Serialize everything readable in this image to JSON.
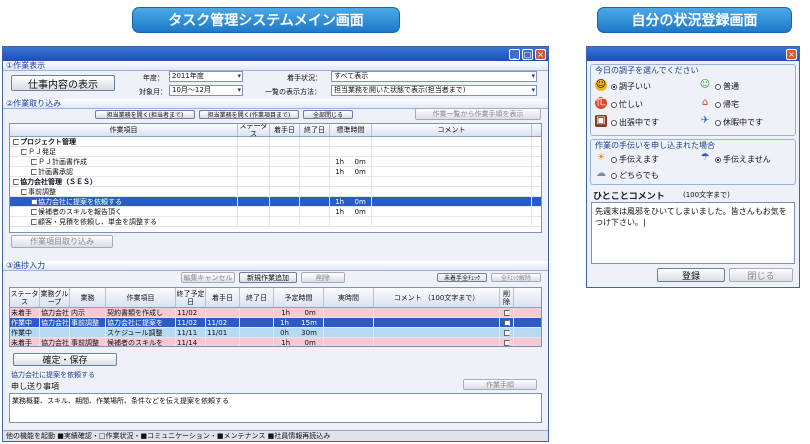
{
  "banners": {
    "main": "タスク管理システムメイン画面",
    "status": "自分の状況登録画面"
  },
  "main": {
    "sec1_title": "①作業表示",
    "show_button": "仕事内容の表示",
    "year_label": "年度：",
    "year_value": "2011年度",
    "period_label": "対象月：",
    "period_value": "10月〜12月",
    "status_label": "着手状況：",
    "status_value": "すべて表示",
    "display_label": "一覧の表示方法：",
    "display_value": "担当業務を開いた状態で表示(担当者まで)",
    "sec2_title": "②作業取り込み",
    "toolbar": [
      "担当業務を開く(担当者まで)",
      "担当業務を開く(作業項目まで)",
      "全部閉じる"
    ],
    "import_button_top": "作業一覧から作業手順を表示",
    "task_cols": [
      "作業項目",
      "ステータス",
      "着手日",
      "終了日",
      "標準時間",
      "コメント"
    ],
    "task_rows": [
      {
        "name": "プロジェクト管理",
        "h": "",
        "m": ""
      },
      {
        "name": "ＰＪ発足",
        "h": "",
        "m": ""
      },
      {
        "name": "ＰＪ計画書作成",
        "h": "1h",
        "m": "0m"
      },
      {
        "name": "計画書承認",
        "h": "1h",
        "m": "0m"
      },
      {
        "name": "協力会社管理（ＳＥＳ）",
        "h": "",
        "m": ""
      },
      {
        "name": "事前調整",
        "h": "",
        "m": ""
      },
      {
        "name": "協力会社に提案を依頼する",
        "h": "1h",
        "m": "0m"
      },
      {
        "name": "候補者のスキルを報告頂く",
        "h": "1h",
        "m": "0m"
      },
      {
        "name": "顧客・見積を依頼し、単金を調整する",
        "h": "",
        "m": ""
      }
    ],
    "import_button": "作業項目取り込み",
    "sec3_title": "③進捗入力",
    "prog_buttons": [
      "編集キャンセル",
      "新規作業追加",
      "削除"
    ],
    "prog_right_buttons": [
      "未着手全ﾁｪｯｸ",
      "全ﾁｪｯｸ解除"
    ],
    "prog_cols": [
      "ステータス",
      "業務グループ",
      "業務",
      "作業項目",
      "終了予定日",
      "着手日",
      "終了日",
      "予定時間",
      "実時間",
      "コメント （100文字まで）",
      "削除"
    ],
    "prog_rows": [
      {
        "status": "未着手",
        "group": "協力会社",
        "biz": "内示",
        "item": "契約書類を作成し",
        "due": "11/02",
        "start": "",
        "end": "",
        "ph": "1h",
        "pm": "0m",
        "style": "pk"
      },
      {
        "status": "作業中",
        "group": "協力会社",
        "biz": "事前調整",
        "item": "協力会社に提案を",
        "due": "11/02",
        "start": "11/02",
        "end": "",
        "ph": "1h",
        "pm": "15m",
        "style": "hl"
      },
      {
        "status": "作業中",
        "group": "",
        "biz": "",
        "item": "スケジュール調整",
        "due": "11/11",
        "start": "11/01",
        "end": "",
        "ph": "0h",
        "pm": "30m",
        "style": "bl"
      },
      {
        "status": "未着手",
        "group": "協力会社",
        "biz": "事前調整",
        "item": "候補者のスキルを",
        "due": "11/14",
        "start": "",
        "end": "",
        "ph": "1h",
        "pm": "0m",
        "style": "pk"
      }
    ],
    "save_button": "確定・保存",
    "selected_task": "協力会社に提案を依頼する",
    "procedure_button": "作業手順",
    "handover_label": "申し送り事項",
    "handover_text": "業務概要、スキル、期間、作業場所、条件などを伝え提案を依頼する",
    "statusbar": "他の機能を起動 ■実績確認・□作業状況・■コミュニケーション・■メンテナンス ■社員情報再読込み"
  },
  "panel": {
    "mood_title": "今日の調子を選んでください",
    "moods": [
      "調子いい",
      "普通",
      "忙しい",
      "帰宅",
      "出張中です",
      "休暇中です"
    ],
    "help_title": "作業の手伝いを申し込まれた場合",
    "helps": [
      "手伝えます",
      "手伝えません",
      "どちらでも"
    ],
    "comment_label": "ひとことコメント",
    "comment_limit": "(100文字まで)",
    "comment_text": "先週末は風邪をひいてしまいました。皆さんもお気をつけ下さい。|",
    "register_button": "登録",
    "close_button": "閉じる"
  }
}
